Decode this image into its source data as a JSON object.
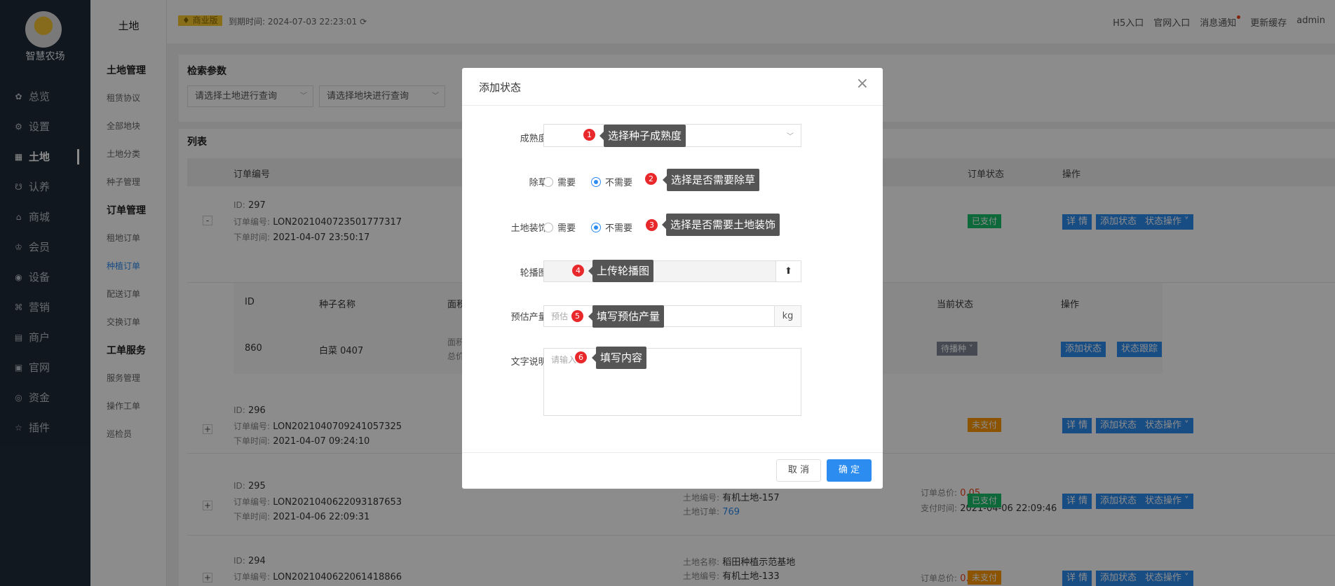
{
  "sidebar": {
    "logo_text": "智慧农场",
    "items": [
      {
        "label": "总览",
        "icon": "dashboard-icon"
      },
      {
        "label": "设置",
        "icon": "gear-icon"
      },
      {
        "label": "土地",
        "icon": "grid-icon"
      },
      {
        "label": "认养",
        "icon": "adopt-icon"
      },
      {
        "label": "商城",
        "icon": "store-icon"
      },
      {
        "label": "会员",
        "icon": "member-icon"
      },
      {
        "label": "设备",
        "icon": "device-icon"
      },
      {
        "label": "营销",
        "icon": "marketing-icon"
      },
      {
        "label": "商户",
        "icon": "merchant-icon"
      },
      {
        "label": "官网",
        "icon": "website-icon"
      },
      {
        "label": "资金",
        "icon": "funds-icon"
      },
      {
        "label": "插件",
        "icon": "plugin-icon"
      }
    ]
  },
  "subnav": {
    "title": "土地",
    "groups": [
      {
        "label": "土地管理",
        "items": [
          "租赁协议",
          "全部地块",
          "土地分类",
          "种子管理"
        ]
      },
      {
        "label": "订单管理",
        "items": [
          "租地订单",
          "种植订单",
          "配送订单",
          "交换订单"
        ]
      },
      {
        "label": "工单服务",
        "items": [
          "服务管理",
          "操作工单",
          "巡检员"
        ]
      }
    ]
  },
  "topbar": {
    "badge": "商业版",
    "expire": "到期时间: 2024-07-03 22:23:01",
    "links": [
      "H5入口",
      "官网入口",
      "消息通知",
      "更新缓存",
      "admin"
    ]
  },
  "search": {
    "title": "检索参数",
    "land_placeholder": "请选择土地进行查询",
    "plot_placeholder": "请选择地块进行查询"
  },
  "list": {
    "title": "列表",
    "headers": {
      "order_no": "订单编号",
      "order_status": "订单状态",
      "action": "操作"
    },
    "labels": {
      "id": "ID:",
      "order_no": "订单编号:",
      "order_time": "下单时间:",
      "land_no": "土地编号:",
      "land_order": "土地订单:",
      "land_name": "土地名称:",
      "total": "订单总价:",
      "pay_time": "支付时间:"
    },
    "buttons": {
      "detail": "详 情",
      "add_state": "添加状态",
      "state_op": "状态操作"
    },
    "rows": [
      {
        "id": "297",
        "order_no": "LON2021040723501777317",
        "time": "2021-04-07 23:50:17",
        "status": "已支付",
        "toggle": "-"
      },
      {
        "id": "296",
        "order_no": "LON2021040709241057325",
        "time": "2021-04-07 09:24:10",
        "status": "未支付",
        "toggle": "+"
      },
      {
        "id": "295",
        "order_no": "LON2021040622093187653",
        "time": "2021-04-06 22:09:31",
        "status": "已支付",
        "toggle": "+",
        "land_no": "有机土地-157",
        "land_order": "769",
        "total": "0.05",
        "pay_time": "2021-04-06 22:09:46"
      },
      {
        "id": "294",
        "order_no": "LON2021040622061418866",
        "time": "",
        "status": "未支付",
        "toggle": "+",
        "land_name": "稻田种植示范基地",
        "land_no": "有机土地-133",
        "total": "0.50"
      }
    ],
    "sub": {
      "headers": {
        "id": "ID",
        "seed": "种子名称",
        "area": "面积",
        "state": "当前状态",
        "action": "操作"
      },
      "row": {
        "id": "860",
        "seed": "白菜 0407",
        "state": "待播种",
        "add_state": "添加状态",
        "track": "状态跟踪",
        "area_label": "面积",
        "total_label": "总价"
      }
    }
  },
  "modal": {
    "title": "添加状态",
    "maturity_label": "成熟度:",
    "weeding_label": "除草:",
    "decor_label": "土地装饰:",
    "carousel_label": "轮播图:",
    "yield_label": "预估产量:",
    "yield_placeholder": "预估",
    "yield_unit": "kg",
    "desc_label": "文字说明:",
    "desc_placeholder": "请输入",
    "need": "需要",
    "no_need": "不需要",
    "cancel": "取 消",
    "ok": "确 定",
    "tips": [
      "选择种子成熟度",
      "选择是否需要除草",
      "选择是否需要土地装饰",
      "上传轮播图",
      "填写预估产量",
      "填写内容"
    ],
    "nums": [
      "1",
      "2",
      "3",
      "4",
      "5",
      "6"
    ]
  },
  "colors": {
    "primary": "#2d8cf0",
    "paid": "#19be6b",
    "unpaid": "#ff9900",
    "price": "#ed4014",
    "sidebar": "#1f2b38"
  }
}
